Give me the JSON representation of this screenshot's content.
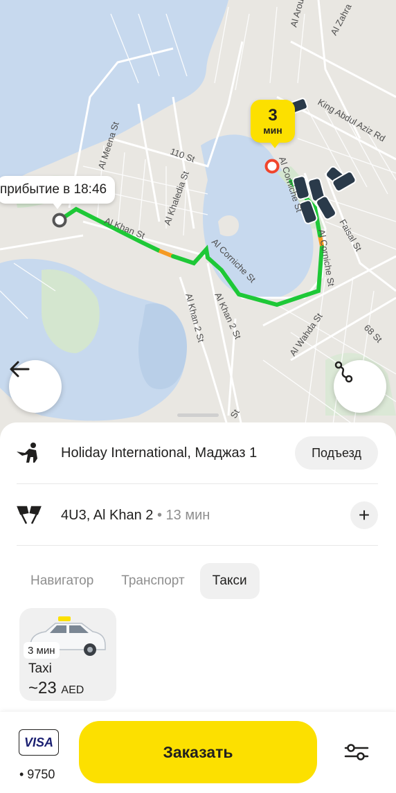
{
  "map": {
    "streets": [
      "Al Meena St",
      "110 St",
      "Al Khaledia St",
      "Al Khan St",
      "Al Corniche St",
      "Al Khan 2 St",
      "King Abdul Aziz Rd",
      "Al Zahra",
      "Al Arou",
      "Faisal St",
      "Al Wahda St",
      "68 St",
      "St"
    ],
    "eta_number": "3",
    "eta_unit": "мин",
    "arrival_text": "прибытие в 18:46"
  },
  "route": {
    "from": "Holiday International, Маджаз 1",
    "entrance_label": "Подъезд",
    "to": "4U3, Al Khan 2",
    "to_duration": "• 13 мин",
    "add_label": "+"
  },
  "tabs": [
    {
      "label": "Навигатор",
      "active": false
    },
    {
      "label": "Транспорт",
      "active": false
    },
    {
      "label": "Такси",
      "active": true
    }
  ],
  "tariff": {
    "eta": "3 мин",
    "name": "Taxi",
    "price": "~23",
    "currency": "AED"
  },
  "payment": {
    "brand": "VISA",
    "card_number": "• 9750"
  },
  "order_label": "Заказать",
  "colors": {
    "accent": "#fce000",
    "route_green": "#1ec837",
    "route_orange": "#f59a23",
    "water": "#c7d9ee",
    "land": "#e9e7e2",
    "park": "#d4e6cf"
  }
}
